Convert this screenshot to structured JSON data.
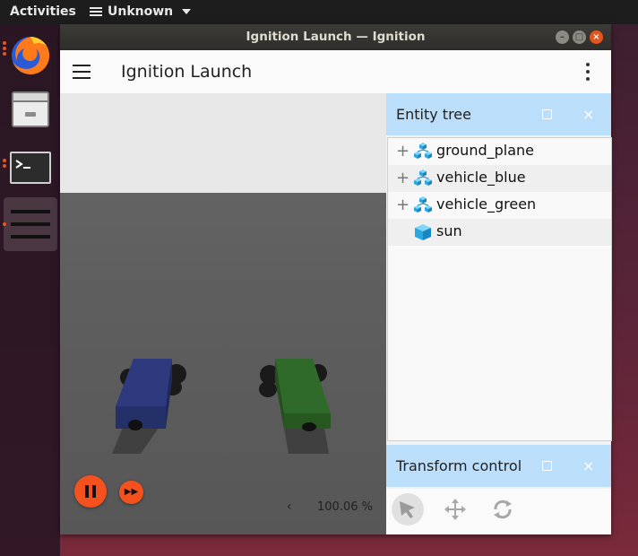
{
  "topbar": {
    "activities_label": "Activities",
    "app_menu_label": "Unknown"
  },
  "dock": {
    "items": [
      "firefox-icon",
      "files-icon",
      "terminal-icon",
      "app-grid-icon"
    ]
  },
  "window": {
    "title": "Ignition Launch — Ignition",
    "app_title": "Ignition Launch"
  },
  "scene": {
    "real_time_factor": "100.06 %",
    "prev_label": "‹",
    "vehicles": [
      {
        "name": "vehicle_blue",
        "color": "#2e3a7d"
      },
      {
        "name": "vehicle_green",
        "color": "#2f6a2a"
      }
    ]
  },
  "entity_tree": {
    "title": "Entity tree",
    "items": [
      {
        "label": "ground_plane",
        "expandable": true
      },
      {
        "label": "vehicle_blue",
        "expandable": true
      },
      {
        "label": "vehicle_green",
        "expandable": true
      },
      {
        "label": "sun",
        "expandable": false
      }
    ]
  },
  "transform_control": {
    "title": "Transform control",
    "tools": [
      "select-icon",
      "translate-icon",
      "rotate-icon"
    ]
  },
  "colors": {
    "accent": "#f4511e",
    "panel_header": "#bbdefb",
    "ubuntu_orange": "#e95420"
  }
}
